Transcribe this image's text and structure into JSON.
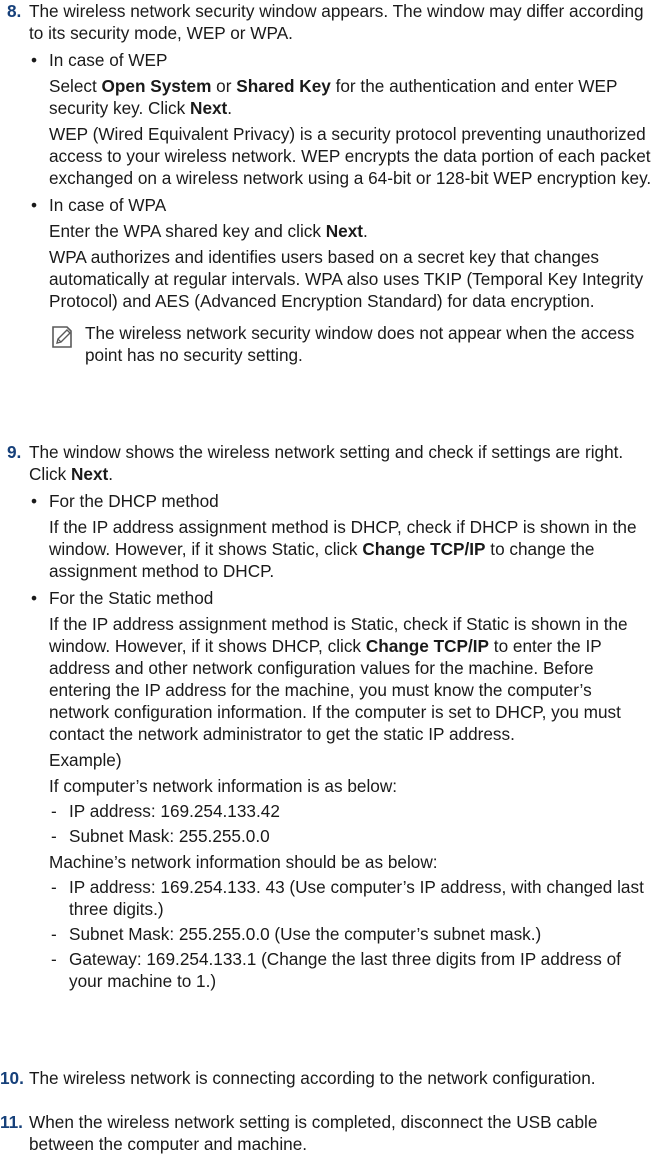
{
  "step8": {
    "number": "8.",
    "intro": "The wireless network security window appears. The window may differ according to its security mode, WEP or WPA.",
    "wep": {
      "heading": "In case of WEP",
      "p1_a": "Select ",
      "p1_open": "Open System",
      "p1_or": " or ",
      "p1_shared": "Shared Key",
      "p1_b": " for the authentication and enter WEP security key. Click ",
      "p1_next": "Next",
      "p1_end": ".",
      "p2": "WEP (Wired Equivalent Privacy) is a security protocol preventing unauthorized access to your wireless network. WEP encrypts the data portion of each packet exchanged on a wireless network using a 64-bit or 128-bit WEP encryption key."
    },
    "wpa": {
      "heading": "In case of WPA",
      "p1_a": "Enter the WPA shared key and click ",
      "p1_next": "Next",
      "p1_end": ".",
      "p2": "WPA authorizes and identifies users based on a secret key that changes automatically at regular intervals. WPA also uses TKIP (Temporal Key Integrity Protocol) and AES (Advanced Encryption Standard) for data encryption."
    },
    "note": "The wireless network security window does not appear when the access point has no security setting."
  },
  "step9": {
    "number": "9.",
    "intro_a": "The window shows the wireless network setting and check if settings are right. Click ",
    "intro_next": "Next",
    "intro_end": ".",
    "dhcp": {
      "heading": "For the DHCP method",
      "p_a": "If the IP address assignment method is DHCP, check if DHCP is shown in the window. However, if it shows Static, click ",
      "p_change": "Change TCP/IP",
      "p_b": " to change the assignment method to DHCP."
    },
    "static": {
      "heading": "For the Static method",
      "p_a": "If the IP address assignment method is Static, check if Static is shown in the window. However, if it shows DHCP, click ",
      "p_change": "Change TCP/IP",
      "p_b": " to enter the IP address and other network configuration values for the machine. Before entering the IP address for the machine, you must know the computer’s network configuration information. If the computer is set to DHCP, you must contact the network administrator to get the static IP address.",
      "example": "Example)",
      "computer_intro": "If computer’s network information is as below:",
      "computer_items": [
        "IP address:   169.254.133.42",
        "Subnet Mask:  255.255.0.0"
      ],
      "machine_intro": "Machine’s network information should be as below:",
      "machine_items": [
        "IP address: 169.254.133. 43 (Use computer’s IP address, with changed last three digits.)",
        "Subnet Mask: 255.255.0.0 (Use the computer’s subnet mask.)",
        "Gateway: 169.254.133.1 (Change the last three digits from IP address of your machine to 1.)"
      ]
    }
  },
  "step10": {
    "number": "10.",
    "text": "The wireless network is connecting according to the network configuration."
  },
  "step11": {
    "number": "11.",
    "text": "When the wireless network setting is completed, disconnect the USB cable between the computer and machine."
  },
  "colors": {
    "step_number": "#16407a",
    "text": "#1a1a1a"
  },
  "icons": {
    "note": "note-pencil-icon"
  }
}
